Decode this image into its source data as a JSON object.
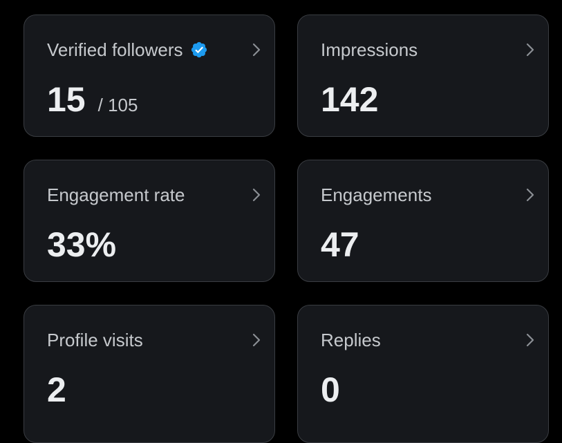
{
  "colors": {
    "background": "#000000",
    "card_background": "#16181c",
    "card_border": "#3a3d42",
    "verified_badge": "#1d9bf0",
    "text_primary": "#eceef0",
    "text_secondary": "#c6c9cd"
  },
  "metrics": [
    {
      "label": "Verified followers",
      "value": "15",
      "total": "/ 105",
      "icon": "verified-badge-icon"
    },
    {
      "label": "Impressions",
      "value": "142"
    },
    {
      "label": "Engagement rate",
      "value": "33%"
    },
    {
      "label": "Engagements",
      "value": "47"
    },
    {
      "label": "Profile visits",
      "value": "2"
    },
    {
      "label": "Replies",
      "value": "0"
    }
  ]
}
